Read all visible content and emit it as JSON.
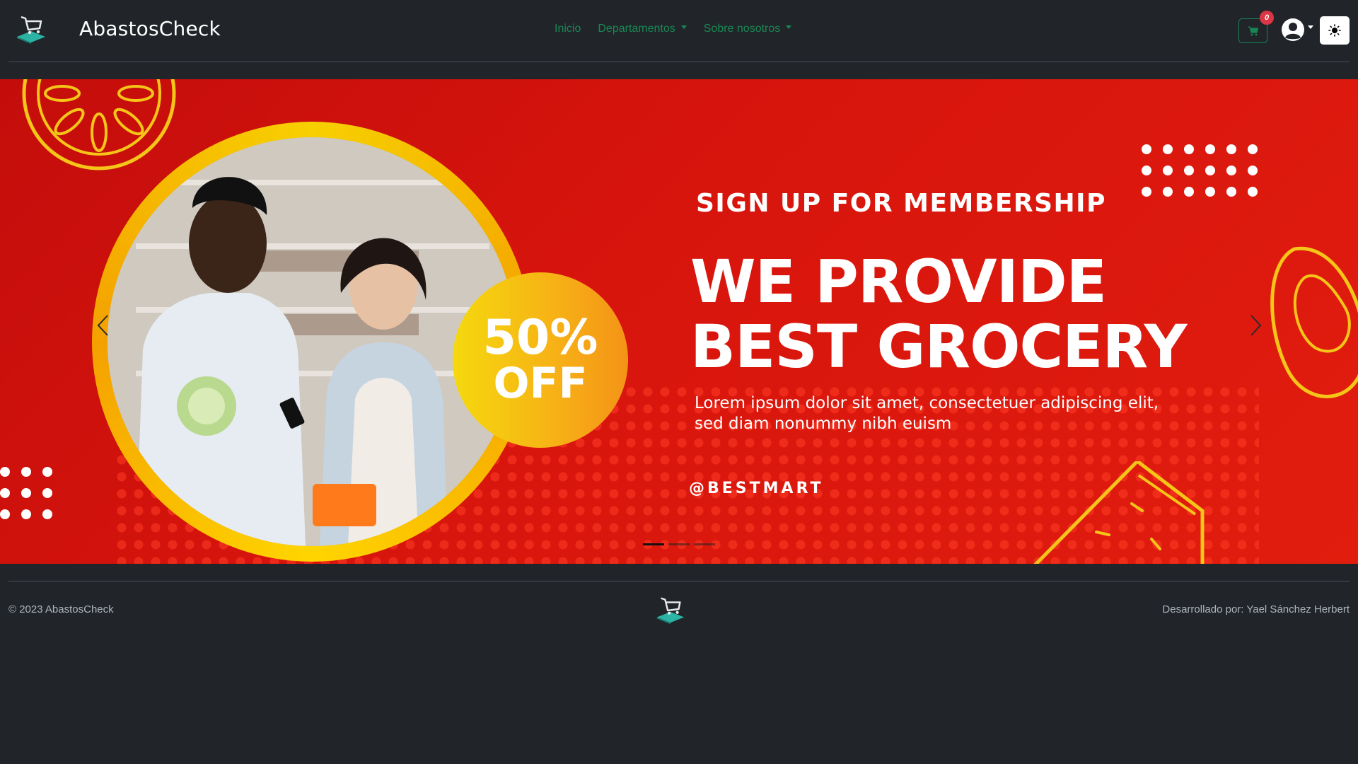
{
  "navbar": {
    "brand": "AbastosCheck",
    "links": [
      {
        "label": "Inicio",
        "dropdown": false
      },
      {
        "label": "Departamentos",
        "dropdown": true
      },
      {
        "label": "Sobre nosotros",
        "dropdown": true
      }
    ],
    "cart_count": "0",
    "icons": {
      "cart": "cart-icon",
      "user": "user-circle-icon",
      "theme": "sun-icon"
    }
  },
  "banner": {
    "subtitle": "SIGN UP FOR MEMBERSHIP",
    "title_line1": "WE PROVIDE",
    "title_line2": "BEST GROCERY",
    "discount_line1": "50%",
    "discount_line2": "OFF",
    "description": "Lorem ipsum dolor sit amet, consectetuer adipiscing elit, sed diam nonummy nibh euism",
    "handle": "@BESTMART",
    "slide_count": 3,
    "active_slide": 1
  },
  "footer": {
    "copyright": "© 2023 AbastosCheck",
    "developer": "Desarrollado por: Yael Sánchez Herbert"
  },
  "colors": {
    "background": "#212529",
    "accent_green": "#198754",
    "badge_red": "#dc3545",
    "banner_red": "#d8150d",
    "banner_yellow": "#f5c518"
  }
}
